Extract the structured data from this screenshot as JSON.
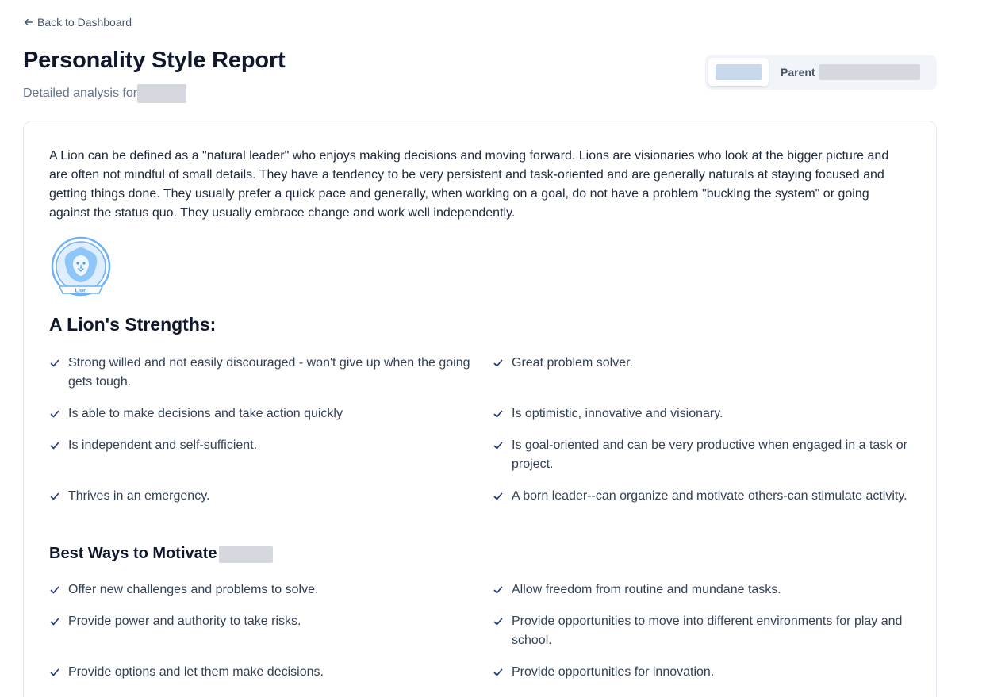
{
  "nav": {
    "back_label": "Back to Dashboard"
  },
  "header": {
    "title": "Personality Style Report",
    "subtitle_prefix": "Detailed analysis for"
  },
  "role_switch": {
    "parent_label": "Parent"
  },
  "report": {
    "intro": "A Lion can be defined as a \"natural leader\" who enjoys making decisions and moving forward. Lions are visionaries who look at the bigger picture and are often not mindful of small details. They have a tendency to be very persistent and task-oriented and are generally naturals at staying focused and getting things done. They usually prefer a quick pace and generally, when working on a goal, do not have a problem \"bucking the system\" or going against the status quo. They usually embrace change and work well independently.",
    "logo_label": "Lion",
    "strengths_heading": "A Lion's Strengths:",
    "strengths": [
      "Strong willed and not easily discouraged - won't give up when the going gets tough.",
      "Great problem solver.",
      "Is able to make decisions and take action quickly",
      "Is optimistic, innovative and visionary.",
      "Is independent and self-sufficient.",
      "Is goal-oriented and can be very productive when engaged in a task or project.",
      "Thrives in an emergency.",
      "A born leader--can organize and motivate others-can stimulate activity."
    ],
    "motivate_heading": "Best Ways to Motivate",
    "motivate": [
      "Offer new challenges and problems to solve.",
      "Allow freedom from routine and mundane tasks.",
      "Provide power and authority to take risks.",
      "Provide opportunities to move into different environments for play and school.",
      "Provide options and let them make decisions.",
      "Provide opportunities for innovation."
    ]
  },
  "colors": {
    "accent": "#1e40af",
    "check": "#1e3a8a",
    "logo": "#60a5fa"
  }
}
